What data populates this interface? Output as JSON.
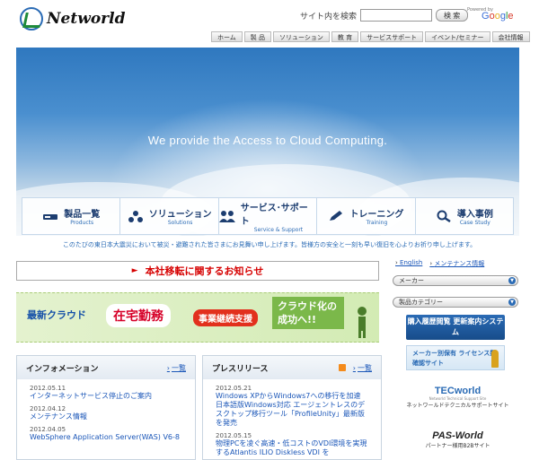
{
  "header": {
    "logo_text": "Networld",
    "search_label": "サイト内を検索",
    "search_value": "",
    "search_button": "検 索",
    "google_small": "Powered by",
    "google_word": "Google"
  },
  "nav": [
    "ホーム",
    "製 品",
    "ソリューション",
    "教 育",
    "サービスサポート",
    "イベント/セミナー",
    "会社情報"
  ],
  "hero": {
    "tagline": "We provide the Access to Cloud Computing.",
    "menu": [
      {
        "ja": "製品一覧",
        "en": "Products",
        "icon": "server-icon"
      },
      {
        "ja": "ソリューション",
        "en": "Solutions",
        "icon": "network-icon"
      },
      {
        "ja": "サービス･サポート",
        "en": "Service & Support",
        "icon": "people-icon"
      },
      {
        "ja": "トレーニング",
        "en": "Training",
        "icon": "pencil-icon"
      },
      {
        "ja": "導入事例",
        "en": "Case Study",
        "icon": "magnifier-icon"
      }
    ]
  },
  "notice_line": "このたびの東日本大震災において被災・避難された皆さまにお見舞い申し上げます。皆様方の安全と一刻も早い復旧を心よりお祈り申し上げます。",
  "move_notice": {
    "arrow": "►",
    "text": "本社移転に関するお知らせ"
  },
  "banner": {
    "t1": "最新クラウド",
    "t2": "在宅勤務",
    "t3": "事業継続支援",
    "t4": "クラウド化の成功へ!!"
  },
  "information": {
    "title": "インフォメーション",
    "list_link": "一覧",
    "items": [
      {
        "date": "2012.05.11",
        "title": "インターネットサービス停止のご案内"
      },
      {
        "date": "2012.04.12",
        "title": "メンテナンス情報"
      },
      {
        "date": "2012.04.05",
        "title": "WebSphere Application Server(WAS) V6-8"
      }
    ]
  },
  "press": {
    "title": "プレスリリース",
    "list_link": "一覧",
    "items": [
      {
        "date": "2012.05.21",
        "title": "Windows XPからWindows7への移行を加速 日本語版Windows対応 エージェントレスのデスクトップ移行ツール「ProfileUnity」最新版を発売"
      },
      {
        "date": "2012.05.15",
        "title": "物理PCを凌ぐ高速・低コストのVDI環境を実現するAtlantis ILIO Diskless VDI を"
      }
    ]
  },
  "sidebar": {
    "links": [
      "English",
      "メンテナンス情報"
    ],
    "select_maker": "メーカー",
    "select_category": "製品カテゴリー",
    "btn1": "購入履歴閲覧 更新案内システム",
    "btn2": "メーカー別保有 ライセンス数確認サイト",
    "tec_logo": "TECworld",
    "tec_small": "Networld Technical Support Site",
    "tec_caption": "ネットワールドテクニカルサポートサイト",
    "pas_logo": "PAS-World",
    "pas_caption": "パートナー様用B2Bサイト"
  },
  "colors": {
    "accent": "#2a6bb5",
    "alert": "#d60000",
    "link": "#1a56b8"
  }
}
